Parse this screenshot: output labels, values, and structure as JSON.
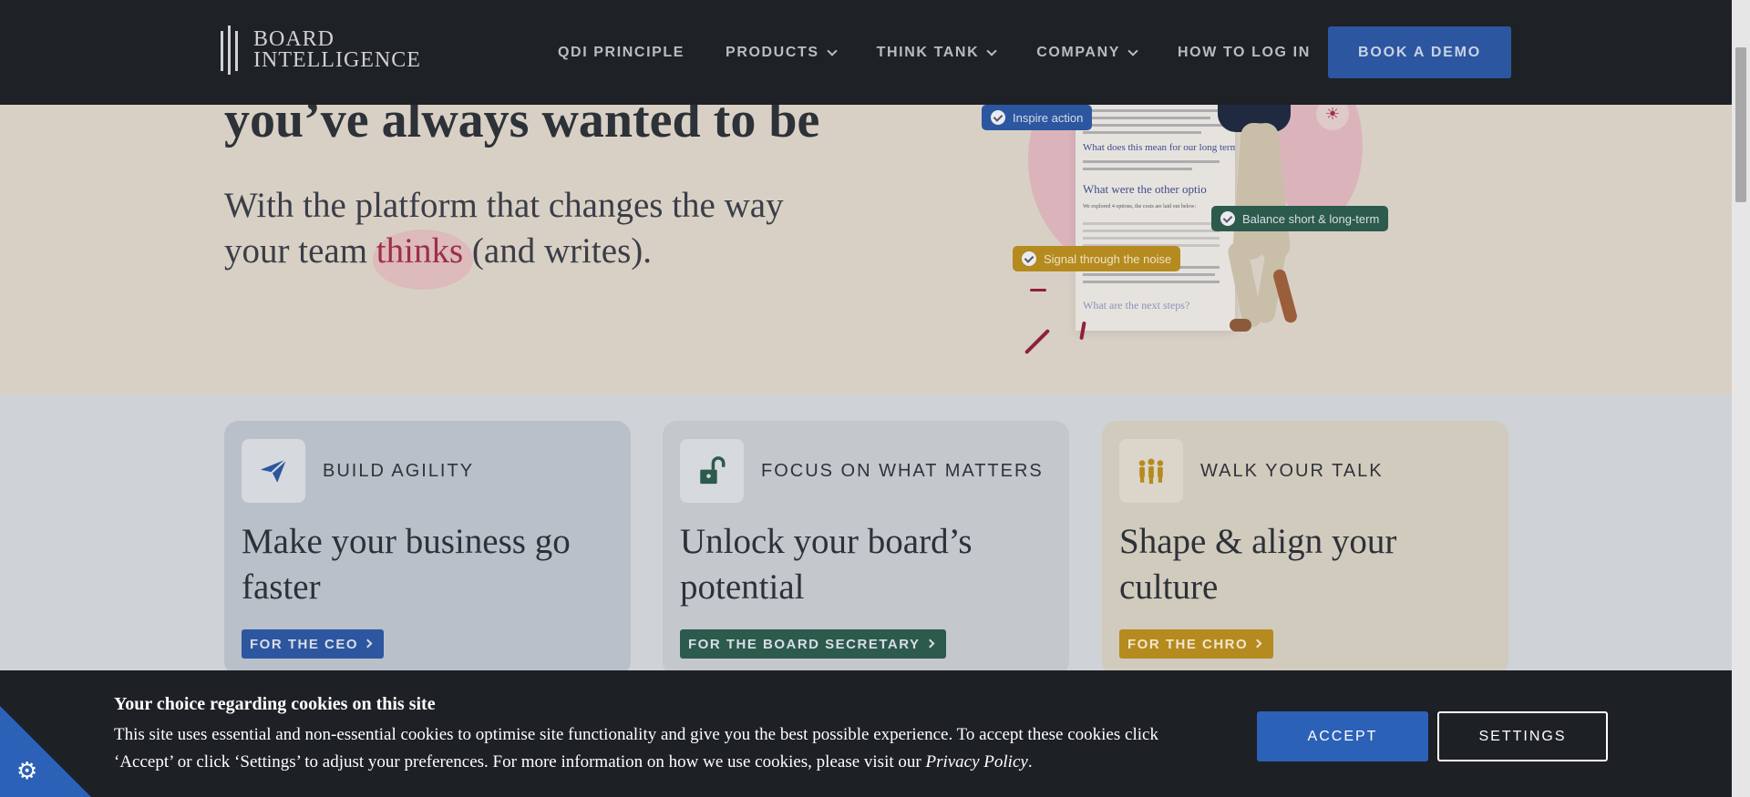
{
  "header": {
    "logo_line1": "BOARD",
    "logo_line2": "INTELLIGENCE",
    "nav": [
      {
        "label": "QDI PRINCIPLE",
        "has_dropdown": false
      },
      {
        "label": "PRODUCTS",
        "has_dropdown": true
      },
      {
        "label": "THINK TANK",
        "has_dropdown": true
      },
      {
        "label": "COMPANY",
        "has_dropdown": true
      },
      {
        "label": "HOW TO LOG IN",
        "has_dropdown": false
      }
    ],
    "cta_label": "BOOK A DEMO"
  },
  "hero": {
    "headline": "you’ve always wanted to be",
    "sub_part1": "With the platform that changes the way",
    "sub_part2": "your team",
    "sub_accent": "thinks",
    "sub_part3": "(and writes).",
    "tags": [
      "Inspire action",
      "Balance short & long-term",
      "Signal through the noise"
    ],
    "doc_headings": [
      "What does this mean for our long term b",
      "What were the other optio",
      "What are the next steps?"
    ],
    "doc_note": "We explored 4 options, the costs are laid out below:"
  },
  "cards": [
    {
      "kicker": "BUILD AGILITY",
      "title": "Make your business go faster",
      "link": "FOR THE CEO",
      "icon": "paper-plane-icon"
    },
    {
      "kicker": "FOCUS ON WHAT MATTERS",
      "title": "Unlock your board’s potential",
      "link": "FOR THE BOARD SECRETARY",
      "icon": "unlocked-padlock-icon"
    },
    {
      "kicker": "WALK YOUR TALK",
      "title": "Shape & align your culture",
      "link": "FOR THE CHRO",
      "icon": "people-group-icon"
    }
  ],
  "cookie": {
    "title": "Your choice regarding cookies on this site",
    "text_before": "This site uses essential and non-essential cookies to optimise site functionality and give you the best possible experience. To accept these cookies click ‘Accept’ or click ‘Settings’ to adjust your preferences. For more information on how we use cookies, please visit our",
    "policy_link": "Privacy Policy",
    "text_after": ".",
    "accept_label": "ACCEPT",
    "settings_label": "SETTINGS"
  },
  "colors": {
    "header_bg": "#1e2125",
    "brand_blue": "#2c56a0",
    "brand_green": "#2c5a4d",
    "brand_gold": "#b58a1e",
    "accent_red": "#9c2f47",
    "hero_bg": "#d9d0c5"
  }
}
